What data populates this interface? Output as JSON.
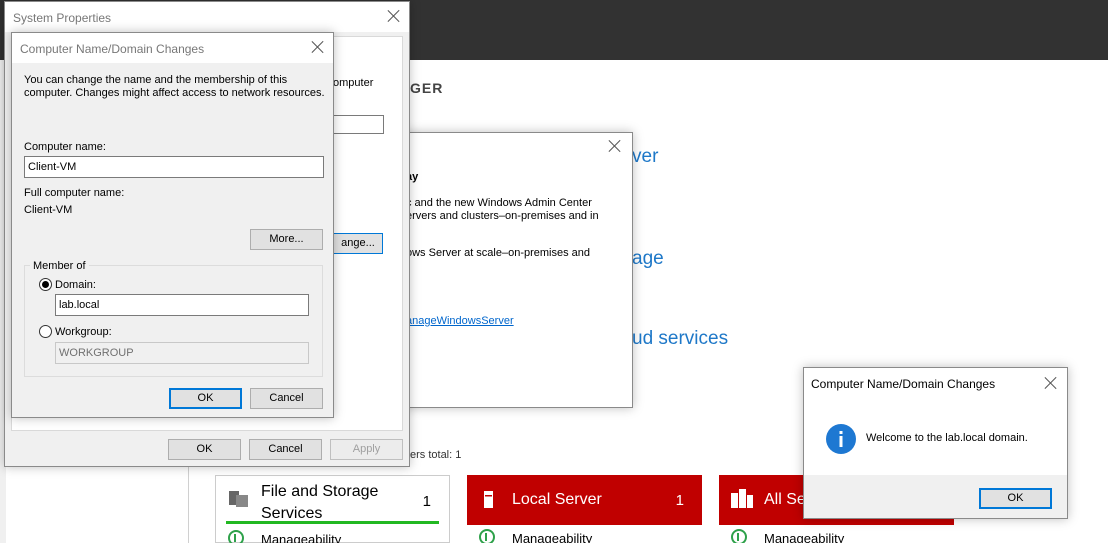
{
  "server_manager": {
    "header_fragment": "GER",
    "link_server_fragment": "ver",
    "link_storage_fragment": "age",
    "link_cloud_fragment": "ud services",
    "servers_total": "ers total: 1",
    "tiles": [
      {
        "title": "File and Storage Services",
        "title_line1": "File and Storage",
        "title_line2": "Services",
        "count": "1",
        "manageability": "Manageability",
        "status_color": "#22b822"
      },
      {
        "title": "Local Server",
        "count": "1",
        "manageability": "Manageability",
        "status_color": "#c00000"
      },
      {
        "title": "All Se",
        "manageability": "Manageability",
        "status_color": "#c00000"
      }
    ]
  },
  "welcome_popup": {
    "heading_fragment": "ay",
    "line1": "c and the new Windows Admin Center",
    "line2": "ervers and clusters–on-premises and in",
    "line3": "ows Server at scale–on-premises and",
    "link": "anageWindowsServer"
  },
  "system_properties": {
    "title": "System Properties",
    "behind_text": "omputer",
    "change_button": "ange...",
    "ok": "OK",
    "cancel": "Cancel",
    "apply": "Apply"
  },
  "name_changes_dialog": {
    "title": "Computer Name/Domain Changes",
    "description_line1": "You can change the name and the membership of this",
    "description_line2": "computer. Changes might affect access to network resources.",
    "computer_name_label": "Computer name:",
    "computer_name_value": "Client-VM",
    "full_name_label": "Full computer name:",
    "full_name_value": "Client-VM",
    "more_button": "More...",
    "member_of_label": "Member of",
    "domain_label": "Domain:",
    "domain_value": "lab.local",
    "workgroup_label": "Workgroup:",
    "workgroup_value": "WORKGROUP",
    "ok": "OK",
    "cancel": "Cancel"
  },
  "welcome_dialog": {
    "title": "Computer Name/Domain Changes",
    "message": "Welcome to the lab.local domain.",
    "ok": "OK",
    "info_icon_color": "#1e78d2"
  }
}
